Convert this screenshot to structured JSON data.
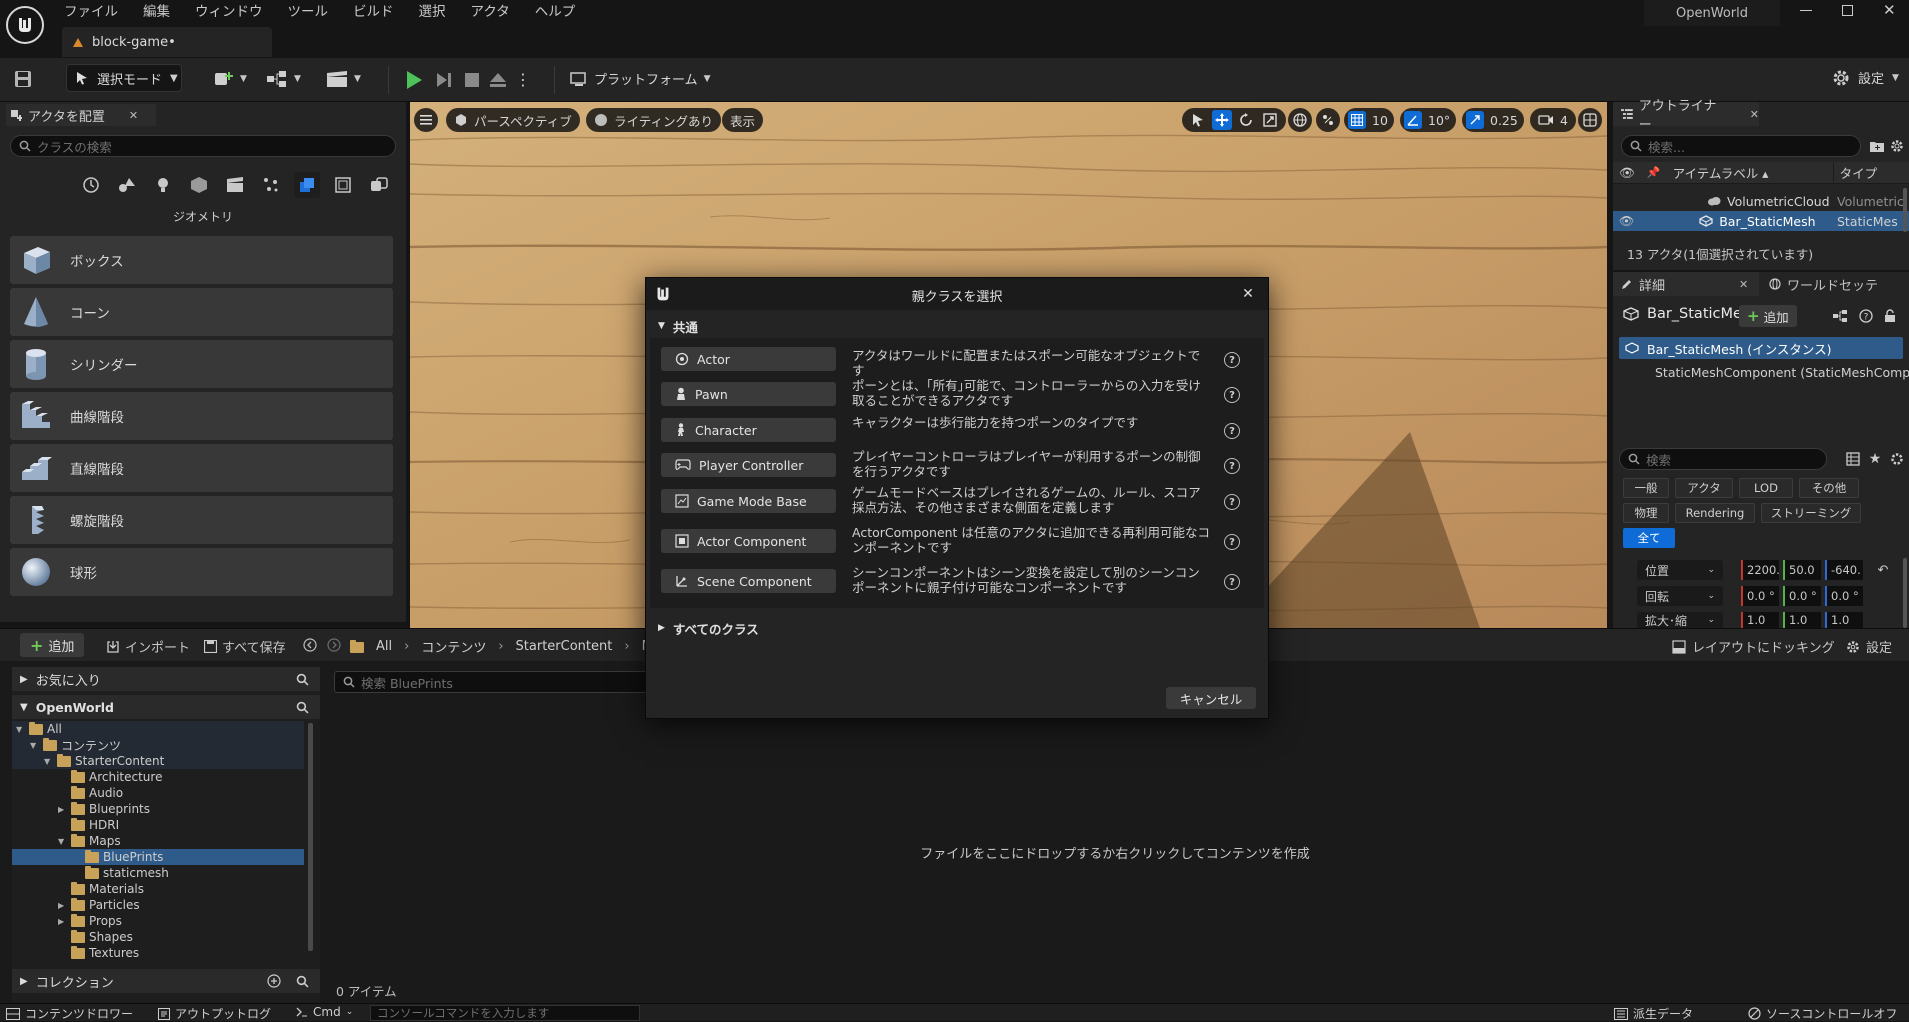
{
  "menu": [
    "ファイル",
    "編集",
    "ウィンドウ",
    "ツール",
    "ビルド",
    "選択",
    "アクタ",
    "ヘルプ"
  ],
  "project_name": "OpenWorld",
  "doc_tab": "block-game•",
  "toolbar": {
    "select_mode": "選択モード",
    "platform": "プラットフォーム",
    "settings": "設定"
  },
  "place_panel": {
    "tab": "アクタを配置",
    "search_placeholder": "クラスの検索",
    "category": "ジオメトリ",
    "items": [
      "ボックス",
      "コーン",
      "シリンダー",
      "曲線階段",
      "直線階段",
      "螺旋階段",
      "球形"
    ]
  },
  "viewport": {
    "perspective": "パースペクティブ",
    "lighting": "ライティングあり",
    "show": "表示",
    "grid": "10",
    "angle": "10°",
    "scale": "0.25",
    "camera": "4"
  },
  "outliner": {
    "tab": "アウトライナー",
    "search_placeholder": "検索...",
    "col_label": "アイテムラベル ▴",
    "col_type": "タイプ",
    "rows": [
      {
        "label": "VolumetricCloud",
        "type": "Volumetric"
      },
      {
        "label": "Bar_StaticMesh",
        "type": "StaticMes"
      }
    ],
    "count": "13 アクタ(1個選択されています)"
  },
  "details": {
    "tab": "詳細",
    "tab2": "ワールドセッテ",
    "actor_name": "Bar_StaticMe",
    "add": "追加",
    "instance": "Bar_StaticMesh (インスタンス)",
    "component": "StaticMeshComponent (StaticMeshComp",
    "search_placeholder": "検索",
    "filters_row1": [
      "一般",
      "アクタ",
      "LOD",
      "その他"
    ],
    "filters_row2": [
      "物理",
      "Rendering",
      "ストリーミング"
    ],
    "filter_all": "全て",
    "location_label": "位置",
    "location": [
      "2200.",
      "50.0",
      "-640."
    ],
    "rotation_label": "回転",
    "rotation": [
      "0.0 °",
      "0.0 °",
      "0.0 °"
    ],
    "scale_label": "拡大･縮",
    "scale": [
      "1.0",
      "1.0",
      "1.0"
    ]
  },
  "content": {
    "add": "追加",
    "import": "インポート",
    "save_all": "すべて保存",
    "breadcrumb": [
      "All",
      "コンテンツ",
      "StarterContent",
      "M"
    ],
    "dock_layout": "レイアウトにドッキング",
    "settings": "設定",
    "favorites": "お気に入り",
    "project": "OpenWorld",
    "tree": [
      {
        "label": "All",
        "depth": 0,
        "open": true
      },
      {
        "label": "コンテンツ",
        "depth": 1,
        "open": true
      },
      {
        "label": "StarterContent",
        "depth": 2,
        "open": true
      },
      {
        "label": "Architecture",
        "depth": 3
      },
      {
        "label": "Audio",
        "depth": 3
      },
      {
        "label": "Blueprints",
        "depth": 3,
        "arrow": true
      },
      {
        "label": "HDRI",
        "depth": 3
      },
      {
        "label": "Maps",
        "depth": 3,
        "open": true
      },
      {
        "label": "BluePrints",
        "depth": 4,
        "selected": true
      },
      {
        "label": "staticmesh",
        "depth": 4
      },
      {
        "label": "Materials",
        "depth": 3
      },
      {
        "label": "Particles",
        "depth": 3,
        "arrow": true
      },
      {
        "label": "Props",
        "depth": 3,
        "arrow": true
      },
      {
        "label": "Shapes",
        "depth": 3
      },
      {
        "label": "Textures",
        "depth": 3
      }
    ],
    "collections": "コレクション",
    "search_placeholder": "検索 BluePrints",
    "empty_hint": "ファイルをここにドロップするか右クリックしてコンテンツを作成",
    "item_count": "0 アイテム"
  },
  "status": {
    "drawer": "コンテンツドロワー",
    "output_log": "アウトプットログ",
    "cmd": "Cmd",
    "console_placeholder": "コンソールコマンドを入力します",
    "derived_data": "派生データ",
    "source_control": "ソースコントロールオフ"
  },
  "dialog": {
    "title": "親クラスを選択",
    "section": "共通",
    "classes": [
      {
        "name": "Actor",
        "desc": "アクタはワールドに配置またはスポーン可能なオブジェクトです"
      },
      {
        "name": "Pawn",
        "desc": "ポーンとは、｢所有｣可能で、コントローラーからの入力を受け取ることができるアクタです"
      },
      {
        "name": "Character",
        "desc": "キャラクターは歩行能力を持つポーンのタイプです"
      },
      {
        "name": "Player Controller",
        "desc": "プレイヤーコントローラはプレイヤーが利用するポーンの制御を行うアクタです"
      },
      {
        "name": "Game Mode Base",
        "desc": "ゲームモードベースはプレイされるゲームの、ルール、スコア採点方法、その他さまざまな側面を定義します"
      },
      {
        "name": "Actor Component",
        "desc": "ActorComponent は任意のアクタに追加できる再利用可能なコンポーネントです"
      },
      {
        "name": "Scene Component",
        "desc": "シーンコンポーネントはシーン変換を設定して別のシーンコンポーネントに親子付け可能なコンポーネントです"
      }
    ],
    "all_classes": "すべてのクラス",
    "cancel": "キャンセル"
  },
  "colors": {
    "accent": "#0f6cd6",
    "select": "#2f5b8a",
    "play": "#4ec25a",
    "folder": "#c9a25a"
  }
}
